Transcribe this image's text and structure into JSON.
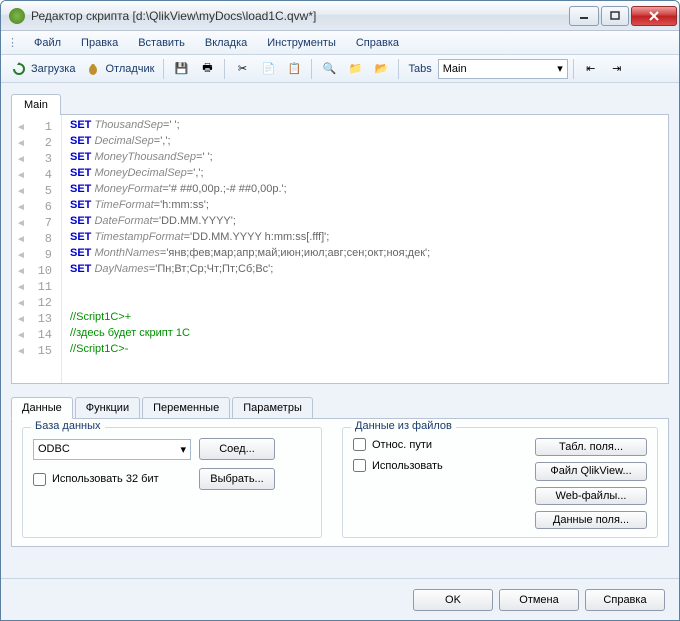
{
  "window": {
    "title": "Редактор скрипта [d:\\QlikView\\myDocs\\load1C.qvw*]"
  },
  "menu": {
    "file": "Файл",
    "edit": "Правка",
    "insert": "Вставить",
    "tab": "Вкладка",
    "tools": "Инструменты",
    "help": "Справка"
  },
  "toolbar": {
    "load": "Загрузка",
    "debugger": "Отладчик",
    "tabs_label": "Tabs",
    "tabs_value": "Main"
  },
  "editor_tab": "Main",
  "code": {
    "lines": [
      {
        "n": 1,
        "kw": "SET",
        "id": "ThousandSep",
        "eq": "=' ';"
      },
      {
        "n": 2,
        "kw": "SET",
        "id": "DecimalSep",
        "eq": "=',';"
      },
      {
        "n": 3,
        "kw": "SET",
        "id": "MoneyThousandSep",
        "eq": "=' ';"
      },
      {
        "n": 4,
        "kw": "SET",
        "id": "MoneyDecimalSep",
        "eq": "=',';"
      },
      {
        "n": 5,
        "kw": "SET",
        "id": "MoneyFormat",
        "eq": "='# ##0,00р.;-# ##0,00р.';"
      },
      {
        "n": 6,
        "kw": "SET",
        "id": "TimeFormat",
        "eq": "='h:mm:ss';"
      },
      {
        "n": 7,
        "kw": "SET",
        "id": "DateFormat",
        "eq": "='DD.MM.YYYY';"
      },
      {
        "n": 8,
        "kw": "SET",
        "id": "TimestampFormat",
        "eq": "='DD.MM.YYYY h:mm:ss[.fff]';"
      },
      {
        "n": 9,
        "kw": "SET",
        "id": "MonthNames",
        "eq": "='янв;фев;мар;апр;май;июн;июл;авг;сен;окт;ноя;дек';"
      },
      {
        "n": 10,
        "kw": "SET",
        "id": "DayNames",
        "eq": "='Пн;Вт;Ср;Чт;Пт;Сб;Вс';"
      },
      {
        "n": 11,
        "blank": true
      },
      {
        "n": 12,
        "blank": true
      },
      {
        "n": 13,
        "cmt": "//Script1C>+"
      },
      {
        "n": 14,
        "cmt": "//здесь будет скрипт 1С"
      },
      {
        "n": 15,
        "cmt": "//Script1C>-"
      }
    ]
  },
  "bottom_tabs": {
    "data": "Данные",
    "functions": "Функции",
    "variables": "Переменные",
    "parameters": "Параметры"
  },
  "db_panel": {
    "legend": "База данных",
    "driver": "ODBC",
    "connect": "Соед...",
    "use32": "Использовать 32 бит",
    "select": "Выбрать..."
  },
  "file_panel": {
    "legend": "Данные из файлов",
    "relative": "Относ. пути",
    "use": "Использовать",
    "table_fields": "Табл. поля...",
    "qlik_file": "Файл QlikView...",
    "web_files": "Web-файлы...",
    "data_fields": "Данные поля..."
  },
  "footer": {
    "ok": "OK",
    "cancel": "Отмена",
    "help": "Справка"
  }
}
